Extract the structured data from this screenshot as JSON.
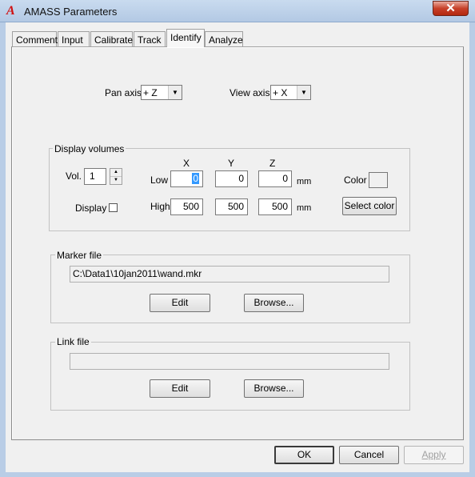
{
  "window": {
    "title": "AMASS Parameters",
    "close_glyph": "✕",
    "icon": "amass-app-icon"
  },
  "tabs": [
    {
      "label": "Comment"
    },
    {
      "label": "Input"
    },
    {
      "label": "Calibrate"
    },
    {
      "label": "Track"
    },
    {
      "label": "Identify",
      "active": true
    },
    {
      "label": "Analyze"
    }
  ],
  "pan_axis": {
    "label": "Pan axis",
    "value": "+ Z"
  },
  "view_axis": {
    "label": "View axis",
    "value": "+ X"
  },
  "display_volumes": {
    "title": "Display volumes",
    "vol_label": "Vol.",
    "vol_value": "1",
    "col_x": "X",
    "col_y": "Y",
    "col_z": "Z",
    "low_label": "Low",
    "high_label": "High",
    "low": {
      "x": "0",
      "y": "0",
      "z": "0"
    },
    "high": {
      "x": "500",
      "y": "500",
      "z": "500"
    },
    "unit": "mm",
    "display_label": "Display",
    "color_label": "Color",
    "select_color": "Select color"
  },
  "marker_file": {
    "title": "Marker file",
    "path": "C:\\Data1\\10jan2011\\wand.mkr",
    "edit": "Edit",
    "browse": "Browse..."
  },
  "link_file": {
    "title": "Link file",
    "path": "",
    "edit": "Edit",
    "browse": "Browse..."
  },
  "buttons": {
    "ok": "OK",
    "cancel": "Cancel",
    "apply": "Apply"
  },
  "glyphs": {
    "down": "▼",
    "up": "▲"
  }
}
